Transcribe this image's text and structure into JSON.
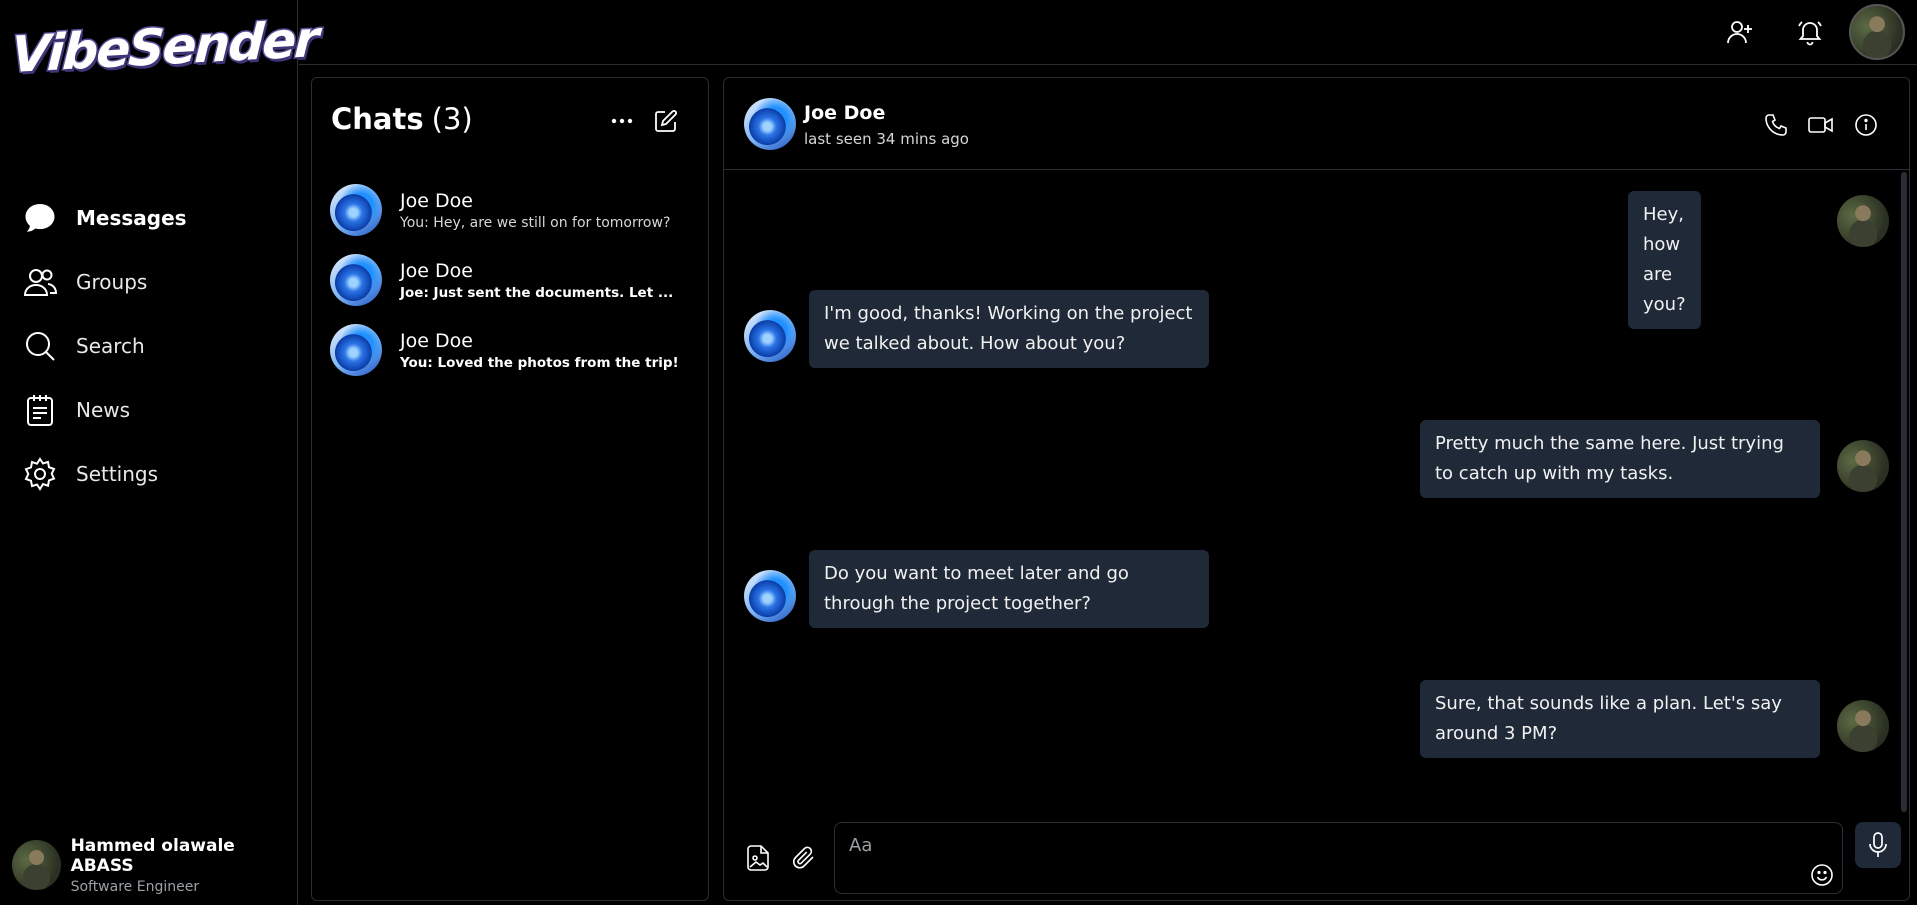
{
  "app": {
    "logo": "VibeSender"
  },
  "sidebar": {
    "items": [
      {
        "label": "Messages",
        "icon": "chat-bubble-icon",
        "active": true
      },
      {
        "label": "Groups",
        "icon": "users-icon"
      },
      {
        "label": "Search",
        "icon": "search-icon"
      },
      {
        "label": "News",
        "icon": "news-icon"
      },
      {
        "label": "Settings",
        "icon": "gear-icon"
      }
    ],
    "profile": {
      "name": "Hammed olawale ABASS",
      "role": "Software Engineer"
    }
  },
  "topbar": {
    "icons": [
      "add-user-icon",
      "bell-icon",
      "avatar"
    ]
  },
  "chats": {
    "title": "Chats",
    "count": "(3)",
    "items": [
      {
        "name": "Joe Doe",
        "preview": "You: Hey, are we still on for tomorrow?",
        "unread": false
      },
      {
        "name": "Joe Doe",
        "preview": "Joe: Just sent the documents. Let ...",
        "unread": true
      },
      {
        "name": "Joe Doe",
        "preview": "You: Loved the photos from the trip!",
        "unread": true
      }
    ]
  },
  "conversation": {
    "contact_name": "Joe Doe",
    "status": "last seen 34 mins ago",
    "messages": [
      {
        "from": "me",
        "text": "Hey, how are you?"
      },
      {
        "from": "them",
        "text": "I'm good, thanks! Working on the project we talked about. How about you?"
      },
      {
        "from": "me",
        "text": "Pretty much the same here. Just trying to catch up with my tasks."
      },
      {
        "from": "them",
        "text": "Do you want to meet later and go through the project together?"
      },
      {
        "from": "me",
        "text": "Sure, that sounds like a plan. Let's say around 3 PM?"
      }
    ],
    "composer": {
      "placeholder": "Aa"
    }
  },
  "colors": {
    "background": "#000000",
    "bubble": "#1f2937",
    "border": "#2a2d33",
    "logo_outline": "#5b4e9c"
  }
}
